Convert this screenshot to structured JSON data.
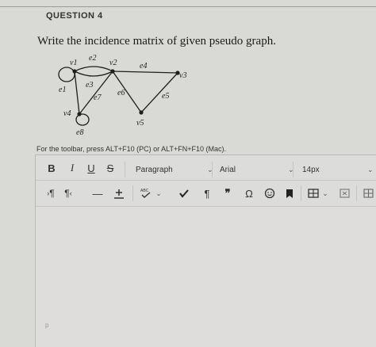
{
  "question": {
    "title": "QUESTION 4",
    "text": "Write the incidence matrix of given pseudo graph."
  },
  "graph": {
    "vertices": [
      "v1",
      "v2",
      "v3",
      "v4",
      "v5"
    ],
    "edges": [
      "e1",
      "e2",
      "e3",
      "e4",
      "e5",
      "e6",
      "e7",
      "e8"
    ]
  },
  "editor": {
    "hint": "For the toolbar, press ALT+F10 (PC) or ALT+FN+F10 (Mac).",
    "toolbar1": {
      "bold": "B",
      "italic": "I",
      "underline": "U",
      "strikethrough": "S",
      "paragraph_format": "Paragraph",
      "font_family": "Arial",
      "font_size": "14px"
    },
    "toolbar2": {
      "ltr": "¶",
      "rtl": "¶",
      "hr": "—",
      "omega": "Ω",
      "quote": "❞",
      "pilcrow": "¶"
    },
    "status_path": "p"
  }
}
